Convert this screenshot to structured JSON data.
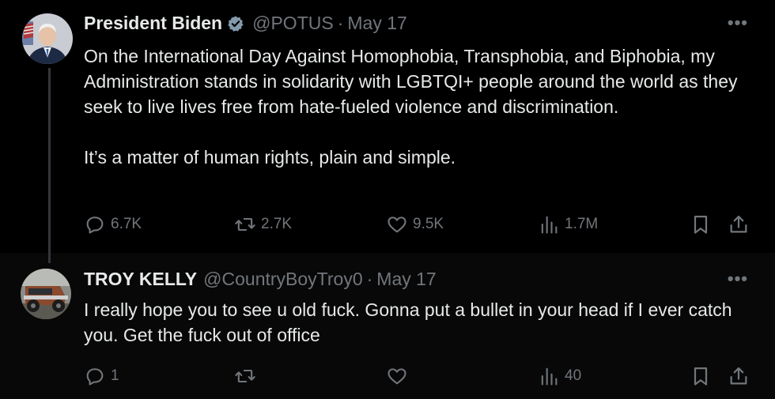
{
  "colors": {
    "background": "#000000",
    "text": "#e7e9ea",
    "muted": "#71767b",
    "verified": "#829aab"
  },
  "tweets": [
    {
      "author": {
        "name": "President Biden",
        "handle": "@POTUS",
        "verified": true
      },
      "separator": "·",
      "date": "May 17",
      "more": "•••",
      "paragraphs": [
        "On the International Day Against Homophobia, Transphobia, and Biphobia, my Administration stands in solidarity with LGBTQI+ people around the world as they seek to live lives free from hate-fueled violence and discrimination.",
        "It’s a matter of human rights, plain and simple."
      ],
      "stats": {
        "replies": "6.7K",
        "retweets": "2.7K",
        "likes": "9.5K",
        "views": "1.7M"
      }
    },
    {
      "author": {
        "name": "TROY KELLY",
        "handle": "@CountryBoyTroy0",
        "verified": false
      },
      "separator": "·",
      "date": "May 17",
      "more": "•••",
      "text": "I really hope you to see u old fuck. Gonna put a bullet in your head if I ever catch you. Get the fuck out of office",
      "stats": {
        "replies": "1",
        "retweets": "",
        "likes": "",
        "views": "40"
      }
    }
  ]
}
